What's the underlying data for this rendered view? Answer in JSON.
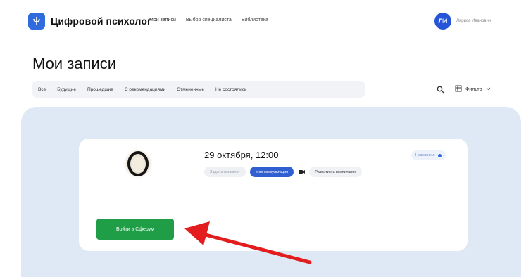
{
  "header": {
    "brand": "Цифровой психолог",
    "nav": [
      {
        "label": "Мои записи",
        "active": true
      },
      {
        "label": "Выбор специалиста",
        "active": false
      },
      {
        "label": "Библиотека",
        "active": false
      }
    ],
    "avatar_initials": "ЛИ",
    "username": "Лариса Иванович"
  },
  "page": {
    "title": "Мои записи"
  },
  "tabs": [
    "Все",
    "Будущие",
    "Прошедшие",
    "С рекомендациями",
    "Отмененные",
    "Не состоялись"
  ],
  "toolbar": {
    "search_icon": "search-icon",
    "filter_label": "Фильтр"
  },
  "card": {
    "date": "29 октября, 12:00",
    "status": "Назначена",
    "chips": {
      "first": "Задача психолог",
      "second": "Моя консультация",
      "third": "Развитие и воспитание"
    },
    "enter_button": "Войти в Сферум"
  },
  "colors": {
    "accent_blue": "#2f6bdc",
    "button_green": "#1f9d47",
    "panel_bg": "#dfe8f5",
    "arrow_red": "#e31d1d"
  }
}
